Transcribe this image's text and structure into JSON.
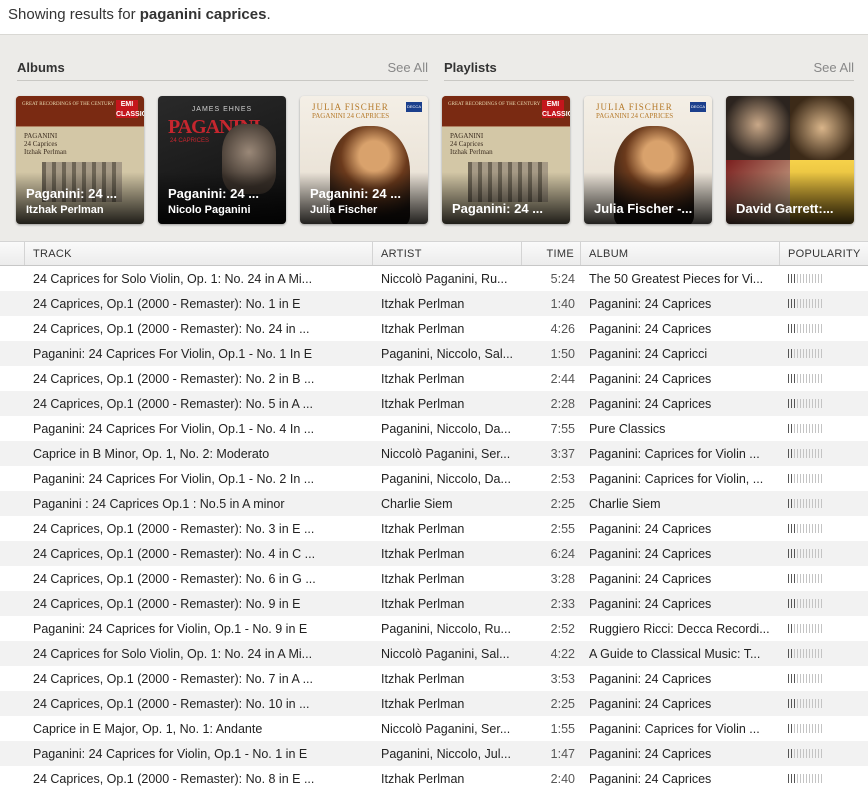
{
  "header": {
    "prefix": "Showing results for ",
    "query": "paganini caprices",
    "suffix": "."
  },
  "albums": {
    "title": "Albums",
    "see_all": "See All",
    "items": [
      {
        "title": "Paganini: 24 ...",
        "artist": "Itzhak Perlman",
        "art": "emi-perlman"
      },
      {
        "title": "Paganini: 24 ...",
        "artist": "Nicolo Paganini",
        "art": "ehnes-paganini"
      },
      {
        "title": "Paganini: 24 ...",
        "artist": "Julia Fischer",
        "art": "fischer-paganini"
      }
    ]
  },
  "playlists": {
    "title": "Playlists",
    "see_all": "See All",
    "items": [
      {
        "title": "Paganini: 24 ...",
        "art": "emi-perlman"
      },
      {
        "title": "Julia Fischer -...",
        "art": "fischer-paganini"
      },
      {
        "title": "David Garrett:...",
        "art": "garrett-collage"
      }
    ]
  },
  "covers": {
    "emi": {
      "strip": "GREAT RECORDINGS OF THE CENTURY",
      "badge": "EMI CLASSICS",
      "line1": "PAGANINI",
      "line2": "24 Caprices",
      "line3": "Itzhak Perlman"
    },
    "ehnes": {
      "name": "JAMES EHNES",
      "big": "PAGANINI",
      "sub": "24 CAPRICES"
    },
    "fischer": {
      "name": "JULIA FISCHER",
      "sub": "PAGANINI 24 CAPRICES",
      "decca": "DECCA"
    }
  },
  "columns": {
    "track": "TRACK",
    "artist": "ARTIST",
    "time": "TIME",
    "album": "ALBUM",
    "popularity": "POPULARITY"
  },
  "tracks": [
    {
      "track": "24 Caprices for Solo Violin, Op. 1: No. 24 in A Mi...",
      "artist": "Niccolò Paganini, Ru...",
      "time": "5:24",
      "album": "The 50 Greatest Pieces for Vi...",
      "popularity": 0.25
    },
    {
      "track": "24 Caprices, Op.1 (2000 - Remaster): No. 1 in E",
      "artist": "Itzhak Perlman",
      "time": "1:40",
      "album": "Paganini: 24 Caprices",
      "popularity": 0.25
    },
    {
      "track": "24 Caprices, Op.1 (2000 - Remaster): No. 24 in ...",
      "artist": "Itzhak Perlman",
      "time": "4:26",
      "album": "Paganini: 24 Caprices",
      "popularity": 0.25
    },
    {
      "track": "Paganini: 24 Caprices For Violin, Op.1 - No. 1 In E",
      "artist": "Paganini, Niccolo, Sal...",
      "time": "1:50",
      "album": "Paganini: 24 Capricci",
      "popularity": 0.17
    },
    {
      "track": "24 Caprices, Op.1 (2000 - Remaster): No. 2 in B ...",
      "artist": "Itzhak Perlman",
      "time": "2:44",
      "album": "Paganini: 24 Caprices",
      "popularity": 0.25
    },
    {
      "track": "24 Caprices, Op.1 (2000 - Remaster): No. 5 in A ...",
      "artist": "Itzhak Perlman",
      "time": "2:28",
      "album": "Paganini: 24 Caprices",
      "popularity": 0.25
    },
    {
      "track": "Paganini: 24 Caprices For Violin, Op.1 - No. 4 In ...",
      "artist": "Paganini, Niccolo, Da...",
      "time": "7:55",
      "album": "Pure Classics",
      "popularity": 0.17
    },
    {
      "track": "Caprice in B Minor, Op. 1, No. 2: Moderato",
      "artist": "Niccolò Paganini, Ser...",
      "time": "3:37",
      "album": "Paganini: Caprices for Violin ...",
      "popularity": 0.17
    },
    {
      "track": "Paganini: 24 Caprices For Violin, Op.1 - No. 2 In ...",
      "artist": "Paganini, Niccolo, Da...",
      "time": "2:53",
      "album": "Paganini: Caprices for Violin, ...",
      "popularity": 0.17
    },
    {
      "track": "Paganini : 24 Caprices Op.1 : No.5 in A minor",
      "artist": "Charlie Siem",
      "time": "2:25",
      "album": "Charlie Siem",
      "popularity": 0.17
    },
    {
      "track": "24 Caprices, Op.1 (2000 - Remaster): No. 3 in E ...",
      "artist": "Itzhak Perlman",
      "time": "2:55",
      "album": "Paganini: 24 Caprices",
      "popularity": 0.25
    },
    {
      "track": "24 Caprices, Op.1 (2000 - Remaster): No. 4 in C ...",
      "artist": "Itzhak Perlman",
      "time": "6:24",
      "album": "Paganini: 24 Caprices",
      "popularity": 0.25
    },
    {
      "track": "24 Caprices, Op.1 (2000 - Remaster): No. 6 in G ...",
      "artist": "Itzhak Perlman",
      "time": "3:28",
      "album": "Paganini: 24 Caprices",
      "popularity": 0.25
    },
    {
      "track": "24 Caprices, Op.1 (2000 - Remaster): No. 9 in E",
      "artist": "Itzhak Perlman",
      "time": "2:33",
      "album": "Paganini: 24 Caprices",
      "popularity": 0.25
    },
    {
      "track": "Paganini: 24 Caprices for Violin, Op.1 - No. 9 in E",
      "artist": "Paganini, Niccolo, Ru...",
      "time": "2:52",
      "album": "Ruggiero Ricci: Decca Recordi...",
      "popularity": 0.17
    },
    {
      "track": "24 Caprices for Solo Violin, Op. 1: No. 24 in A Mi...",
      "artist": "Niccolò Paganini, Sal...",
      "time": "4:22",
      "album": "A Guide to Classical Music: T...",
      "popularity": 0.17
    },
    {
      "track": "24 Caprices, Op.1 (2000 - Remaster): No. 7 in A ...",
      "artist": "Itzhak Perlman",
      "time": "3:53",
      "album": "Paganini: 24 Caprices",
      "popularity": 0.25
    },
    {
      "track": "24 Caprices, Op.1 (2000 - Remaster): No. 10 in ...",
      "artist": "Itzhak Perlman",
      "time": "2:25",
      "album": "Paganini: 24 Caprices",
      "popularity": 0.25
    },
    {
      "track": "Caprice in E Major, Op. 1, No. 1: Andante",
      "artist": "Niccolò Paganini, Ser...",
      "time": "1:55",
      "album": "Paganini: Caprices for Violin ...",
      "popularity": 0.17
    },
    {
      "track": "Paganini: 24 Caprices for Violin, Op.1 - No. 1 in E",
      "artist": "Paganini, Niccolo, Jul...",
      "time": "1:47",
      "album": "Paganini: 24 Caprices",
      "popularity": 0.17
    },
    {
      "track": "24 Caprices, Op.1 (2000 - Remaster): No. 8 in E ...",
      "artist": "Itzhak Perlman",
      "time": "2:40",
      "album": "Paganini: 24 Caprices",
      "popularity": 0.25
    }
  ]
}
